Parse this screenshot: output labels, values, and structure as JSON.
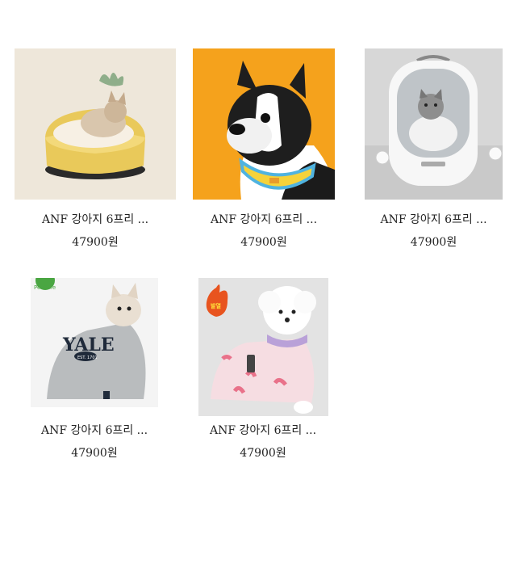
{
  "products": [
    {
      "name": "ANF 강아지 6프리 ...",
      "price": "47900원",
      "image": "cat-in-yellow-bed"
    },
    {
      "name": "ANF 강아지 6프리 ...",
      "price": "47900원",
      "image": "french-bulldog-orange-background"
    },
    {
      "name": "ANF 강아지 6프리 ...",
      "price": "47900원",
      "image": "cat-in-capsule-carrier"
    },
    {
      "name": "ANF 강아지 6프리 ...",
      "price": "47900원",
      "image": "french-bulldog-gray-hoodie",
      "badge": "PetCare",
      "hoodie_text": "YALE",
      "hoodie_subtext": "EST. 1701"
    },
    {
      "name": "ANF 강아지 6프리 ...",
      "price": "47900원",
      "image": "poodle-pink-fleece-vest",
      "badge": "발열"
    }
  ]
}
